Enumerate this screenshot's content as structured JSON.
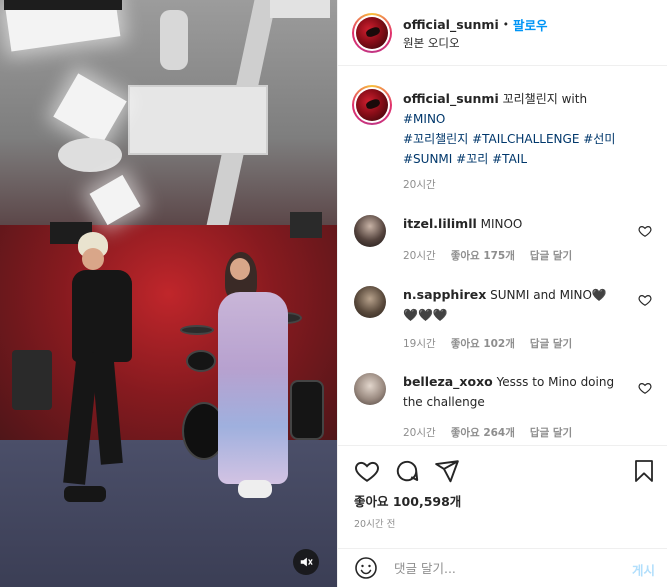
{
  "header": {
    "username": "official_sunmi",
    "separator": "•",
    "follow_label": "팔로우",
    "audio_label": "원본 오디오"
  },
  "caption": {
    "username": "official_sunmi",
    "text": "꼬리챌린지 with",
    "tags_line1": "#MINO",
    "tags_line2": [
      "#꼬리챌린지",
      "#TAILCHALLENGE",
      "#선미"
    ],
    "tags_line3": [
      "#SUNMI",
      "#꼬리",
      "#TAIL"
    ],
    "time": "20시간"
  },
  "comments": [
    {
      "username": "itzel.lilimll",
      "text": "MINOO",
      "time": "20시간",
      "likes": "좋아요 175개",
      "reply": "답글 달기"
    },
    {
      "username": "n.sapphirex",
      "text": "SUNMI and MINO🖤",
      "text2": "🖤🖤🖤",
      "time": "19시간",
      "likes": "좋아요 102개",
      "reply": "답글 달기"
    },
    {
      "username": "belleza_xoxo",
      "text": "Yesss to Mino doing",
      "text2": "the challenge",
      "time": "20시간",
      "likes": "좋아요 264개",
      "reply": "답글 달기"
    }
  ],
  "actions": {
    "likes_label": "좋아요 100,598개",
    "time_ago": "20시간 전"
  },
  "composer": {
    "placeholder": "댓글 달기...",
    "post_label": "게시"
  },
  "icons": {
    "mute": "muted-speaker-icon",
    "like": "heart-icon",
    "comment": "comment-bubble-icon",
    "share": "paper-plane-icon",
    "save": "bookmark-icon",
    "emoji": "smiley-icon"
  },
  "colors": {
    "link_blue": "#0095f6",
    "hashtag": "#00376b",
    "secondary_text": "#8e8e8e",
    "post_disabled": "#b2dffc"
  }
}
